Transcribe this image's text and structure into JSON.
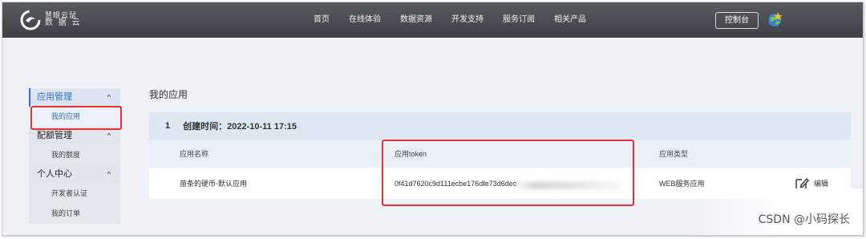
{
  "brand": {
    "line1": "慧眼云鼠",
    "line2": "数 据 云",
    "logo_icon": "swirl-logo-icon"
  },
  "nav": {
    "items": [
      "首页",
      "在线体验",
      "数据资源",
      "开发支持",
      "服务订阅",
      "相关产品"
    ]
  },
  "header": {
    "console_label": "控制台",
    "avatar_icon": "globe-avatar-icon"
  },
  "sidebar": {
    "groups": [
      {
        "label": "应用管理",
        "items": [
          "我的应用"
        ]
      },
      {
        "label": "配额管理",
        "items": [
          "我的额度"
        ]
      },
      {
        "label": "个人中心",
        "items": [
          "开发者认证",
          "我的订单"
        ]
      }
    ],
    "chevron": "^"
  },
  "main": {
    "title": "我的应用",
    "app": {
      "index": "1",
      "created": "创建时间：2022-10-11 17:15",
      "columns": [
        "应用名称",
        "应用token",
        "应用类型"
      ],
      "row": {
        "name": "苗条的硬币-默认应用",
        "token": "0f41d7620c9d111ecbe176dfe73d6dec",
        "type": "WEB服务应用",
        "edit_label": "编辑"
      }
    }
  },
  "watermark": "CSDN @小码探长",
  "colors": {
    "accent": "#2f6fd6",
    "highlight": "#e53333",
    "topbar": "#4a4e55"
  }
}
